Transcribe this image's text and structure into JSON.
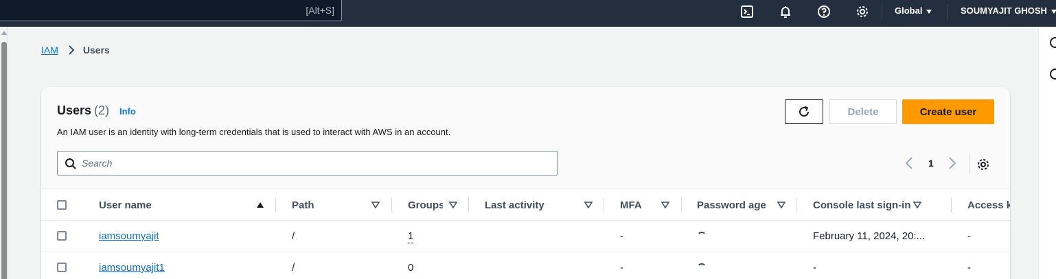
{
  "topnav": {
    "search_shortcut": "[Alt+S]",
    "region": "Global",
    "account": "SOUMYAJIT GHOSH",
    "icons": [
      "cloudshell-icon",
      "bell-icon",
      "help-icon",
      "settings-icon"
    ]
  },
  "breadcrumb": {
    "parent": "IAM",
    "current": "Users"
  },
  "users_panel": {
    "title": "Users",
    "count": "(2)",
    "info": "Info",
    "description": "An IAM user is an identity with long-term credentials that is used to interact with AWS in an account.",
    "buttons": {
      "delete": "Delete",
      "create": "Create user"
    },
    "search_placeholder": "Search",
    "page": "1",
    "columns": [
      "User name",
      "Path",
      "Groups",
      "Last activity",
      "MFA",
      "Password age",
      "Console last sign-in",
      "Access k"
    ],
    "rows": [
      {
        "user_name": "iamsoumyajit",
        "path": "/",
        "groups": "1",
        "last_activity": "",
        "mfa": "-",
        "console_last_sign_in": "February 11, 2024, 20:...",
        "access_key": "-"
      },
      {
        "user_name": "iamsoumyajit1",
        "path": "/",
        "groups": "0",
        "last_activity": "",
        "mfa": "-",
        "console_last_sign_in": "-",
        "access_key": "-"
      }
    ]
  },
  "colors": {
    "nav_bg": "#232f3e",
    "primary_button": "#ff9900",
    "link": "#0972d3"
  }
}
